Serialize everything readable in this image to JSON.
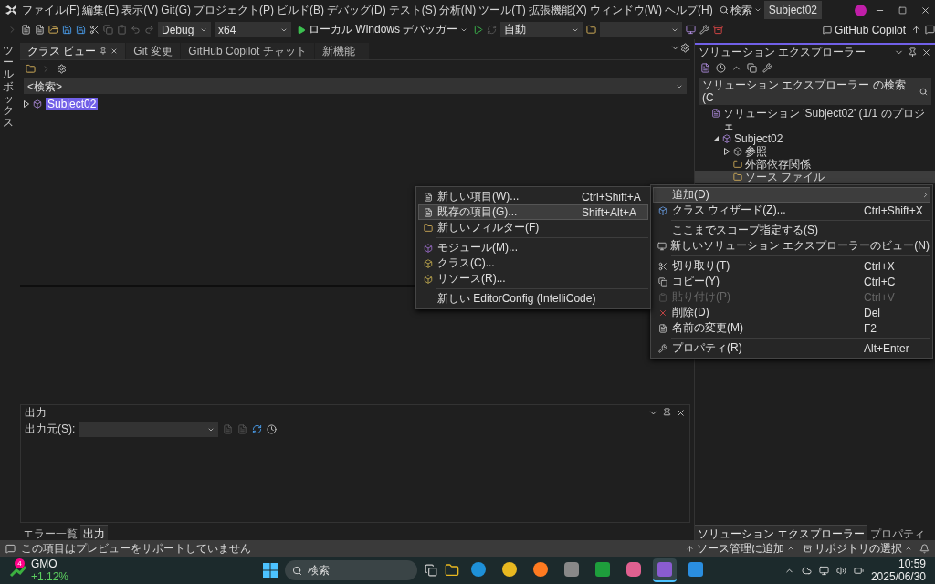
{
  "menu_bar": {
    "items": [
      "ファイル(F)",
      "編集(E)",
      "表示(V)",
      "Git(G)",
      "プロジェクト(P)",
      "ビルド(B)",
      "デバッグ(D)",
      "テスト(S)",
      "分析(N)",
      "ツール(T)",
      "拡張機能(X)",
      "ウィンドウ(W)",
      "ヘルプ(H)"
    ],
    "search": "検索",
    "title": "Subject02"
  },
  "toolbar": {
    "configuration": "Debug",
    "platform": "x64",
    "run_label": "ローカル Windows デバッガー",
    "mode": "自動",
    "copilot": "GitHub Copilot"
  },
  "toolbox_strip": "ツールボックス",
  "doc_tabs": [
    {
      "label": "クラス ビュー",
      "selected": true
    },
    {
      "label": "Git 変更",
      "selected": false
    },
    {
      "label": "GitHub Copilot チャット",
      "selected": false
    },
    {
      "label": "新機能",
      "selected": false
    }
  ],
  "class_view": {
    "search_placeholder": "<検索>",
    "tree": [
      {
        "label": "Subject02",
        "selected": true,
        "expanded": false
      }
    ]
  },
  "output_panel": {
    "title": "出力",
    "source_label": "出力元(S):",
    "tabs": [
      {
        "label": "エラー一覧",
        "selected": false
      },
      {
        "label": "出力",
        "selected": true
      }
    ]
  },
  "solution_explorer": {
    "title": "ソリューション エクスプローラー",
    "search_placeholder": "ソリューション エクスプローラー の検索 (C",
    "tree": [
      {
        "label": "ソリューション 'Subject02' (1/1 のプロジェ",
        "kind": "solution",
        "selected": false,
        "children": [
          {
            "label": "Subject02",
            "kind": "project",
            "selected": false,
            "expanded": true,
            "children": [
              {
                "label": "参照",
                "kind": "references",
                "selected": false,
                "expanded": false
              },
              {
                "label": "外部依存関係",
                "kind": "folder",
                "selected": false
              },
              {
                "label": "ソース ファイル",
                "kind": "folder",
                "selected": true
              }
            ]
          }
        ]
      }
    ],
    "tabs": [
      {
        "label": "ソリューション エクスプローラー",
        "selected": true
      },
      {
        "label": "プロパティ",
        "selected": false
      }
    ]
  },
  "context_menu": {
    "items": [
      {
        "kind": "item",
        "label": "追加(D)",
        "submenu": true,
        "selected": true,
        "disabled": false
      },
      {
        "kind": "item",
        "label": "クラス ウィザード(Z)...",
        "shortcut": "Ctrl+Shift+X",
        "selected": false,
        "disabled": false
      },
      {
        "kind": "separator"
      },
      {
        "kind": "item",
        "label": "ここまでスコープ指定する(S)",
        "selected": false,
        "disabled": false
      },
      {
        "kind": "item",
        "label": "新しいソリューション エクスプローラーのビュー(N)",
        "selected": false,
        "disabled": false
      },
      {
        "kind": "separator"
      },
      {
        "kind": "item",
        "label": "切り取り(T)",
        "shortcut": "Ctrl+X",
        "selected": false,
        "disabled": false
      },
      {
        "kind": "item",
        "label": "コピー(Y)",
        "shortcut": "Ctrl+C",
        "selected": false,
        "disabled": false
      },
      {
        "kind": "item",
        "label": "貼り付け(P)",
        "shortcut": "Ctrl+V",
        "selected": false,
        "disabled": true
      },
      {
        "kind": "item",
        "label": "削除(D)",
        "shortcut": "Del",
        "selected": false,
        "disabled": false
      },
      {
        "kind": "item",
        "label": "名前の変更(M)",
        "shortcut": "F2",
        "selected": false,
        "disabled": false
      },
      {
        "kind": "separator"
      },
      {
        "kind": "item",
        "label": "プロパティ(R)",
        "shortcut": "Alt+Enter",
        "selected": false,
        "disabled": false
      }
    ]
  },
  "submenu": {
    "items": [
      {
        "kind": "item",
        "label": "新しい項目(W)...",
        "shortcut": "Ctrl+Shift+A",
        "selected": false
      },
      {
        "kind": "item",
        "label": "既存の項目(G)...",
        "shortcut": "Shift+Alt+A",
        "selected": true
      },
      {
        "kind": "item",
        "label": "新しいフィルター(F)",
        "selected": false
      },
      {
        "kind": "separator"
      },
      {
        "kind": "item",
        "label": "モジュール(M)...",
        "selected": false
      },
      {
        "kind": "item",
        "label": "クラス(C)...",
        "selected": false
      },
      {
        "kind": "item",
        "label": "リソース(R)...",
        "selected": false
      },
      {
        "kind": "separator"
      },
      {
        "kind": "item",
        "label": "新しい EditorConfig (IntelliCode)",
        "selected": false
      }
    ]
  },
  "status_bar": {
    "message": "この項目はプレビューをサポートしていません",
    "items": [
      "ソース管理に追加",
      "リポジトリの選択"
    ]
  },
  "taskbar": {
    "widget": {
      "badge": "4",
      "name": "GMO",
      "change": "+1.12%"
    },
    "search_placeholder": "検索",
    "apps": [
      {
        "selected": false
      },
      {
        "selected": false
      },
      {
        "selected": false
      },
      {
        "selected": false
      },
      {
        "selected": false
      },
      {
        "selected": false
      },
      {
        "selected": true
      },
      {
        "selected": false
      }
    ],
    "time": "10:59",
    "date": "2025/06/30"
  }
}
